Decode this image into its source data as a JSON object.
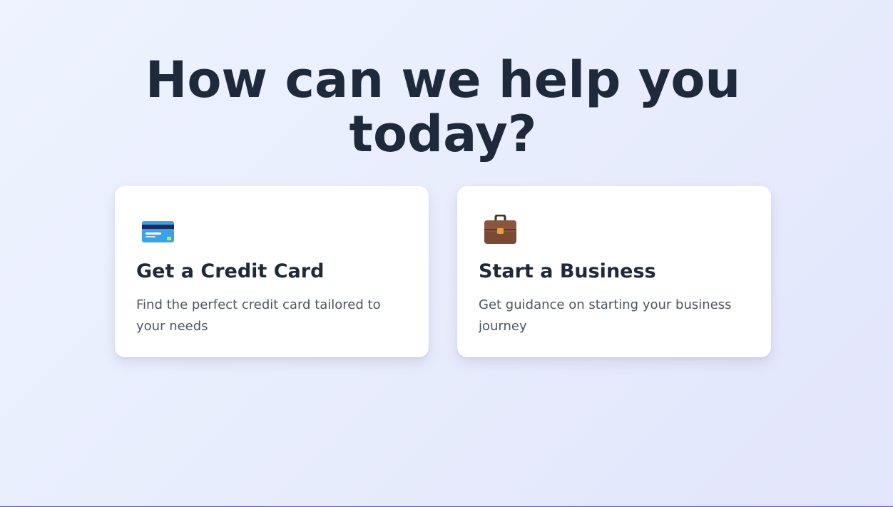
{
  "main": {
    "title_line1": "How can we help you",
    "title_line2": "today?"
  },
  "cards": [
    {
      "icon": "credit-card-icon",
      "title": "Get a Credit Card",
      "description": "Find the perfect credit card tailored to your needs"
    },
    {
      "icon": "briefcase-icon",
      "title": "Start a Business",
      "description": "Get guidance on starting your business journey"
    }
  ],
  "colors": {
    "heading": "#1e293b",
    "description": "#4b5563",
    "card_background": "#ffffff",
    "page_background": "#e8edfd"
  }
}
